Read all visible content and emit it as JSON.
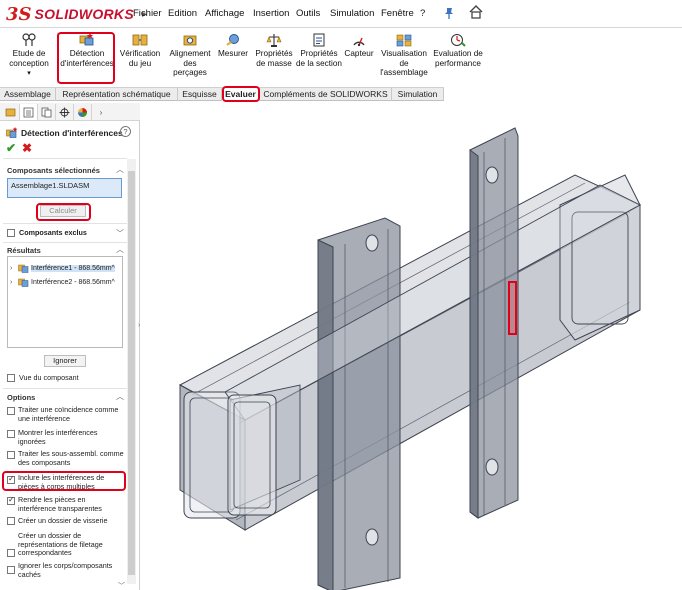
{
  "app": {
    "logo_ds": "3S",
    "logo_text": "SOLIDWORKS",
    "brand_color": "#c8102e"
  },
  "menu": {
    "items": [
      "Fichier",
      "Edition",
      "Affichage",
      "Insertion",
      "Outils",
      "Simulation",
      "Fenêtre",
      "?"
    ],
    "pin_icon": "pin-icon",
    "home_icon": "home-icon"
  },
  "ribbon": {
    "buttons": [
      {
        "label": "Etude de conception",
        "icon": "design-study-icon"
      },
      {
        "label": "Détection d'interférences",
        "icon": "interference-detection-icon"
      },
      {
        "label": "Vérification du jeu",
        "icon": "clearance-verification-icon"
      },
      {
        "label": "Alignement des perçages",
        "icon": "hole-alignment-icon"
      },
      {
        "label": "Mesurer",
        "icon": "measure-icon"
      },
      {
        "label": "Propriétés de masse",
        "icon": "mass-properties-icon"
      },
      {
        "label": "Propriétés de la section",
        "icon": "section-properties-icon"
      },
      {
        "label": "Capteur",
        "icon": "sensor-icon"
      },
      {
        "label": "Visualisation de l'assemblage",
        "icon": "assembly-visualization-icon"
      },
      {
        "label": "Evaluation de performance",
        "icon": "performance-evaluation-icon"
      }
    ],
    "design_study_label_1": "Etude de",
    "design_study_label_2": "conception"
  },
  "tabs": {
    "items": [
      "Assemblage",
      "Représentation schématique",
      "Esquisse",
      "Evaluer",
      "Compléments de SOLIDWORKS",
      "Simulation"
    ],
    "active": "Evaluer"
  },
  "property_manager": {
    "title": "Détection d'interférences",
    "help": "?",
    "ok_symbol": "✔",
    "cancel_symbol": "✖",
    "selected_components": {
      "title": "Composants sélectionnés",
      "value": "Assemblage1.SLDASM",
      "calculate_label": "Calculer"
    },
    "excluded_components": {
      "label": "Composants exclus",
      "checked": false
    },
    "results": {
      "title": "Résultats",
      "items": [
        "Interférence1 - 868.56mm^",
        "Interférence2 - 868.56mm^"
      ],
      "ignore_label": "Ignorer",
      "component_view_label": "Vue du composant",
      "component_view_checked": false
    },
    "options": {
      "title": "Options",
      "items": [
        {
          "label": "Traiter une coïncidence comme une interférence",
          "checked": false
        },
        {
          "label": "Montrer les interférences ignorées",
          "checked": false
        },
        {
          "label": "Traiter les sous-assembl. comme des composants",
          "checked": false
        },
        {
          "label": "Inclure les interférences de pièces à corps multiples",
          "checked": true
        },
        {
          "label": "Rendre les pièces en interférence transparentes",
          "checked": true
        },
        {
          "label": "Créer un dossier de visserie",
          "checked": false
        },
        {
          "label": "Créer un dossier de représentations de filetage correspondantes",
          "checked": false
        },
        {
          "label": "Ignorer les corps/composants cachés",
          "checked": false
        }
      ]
    }
  },
  "highlight_color": "#e0001b"
}
